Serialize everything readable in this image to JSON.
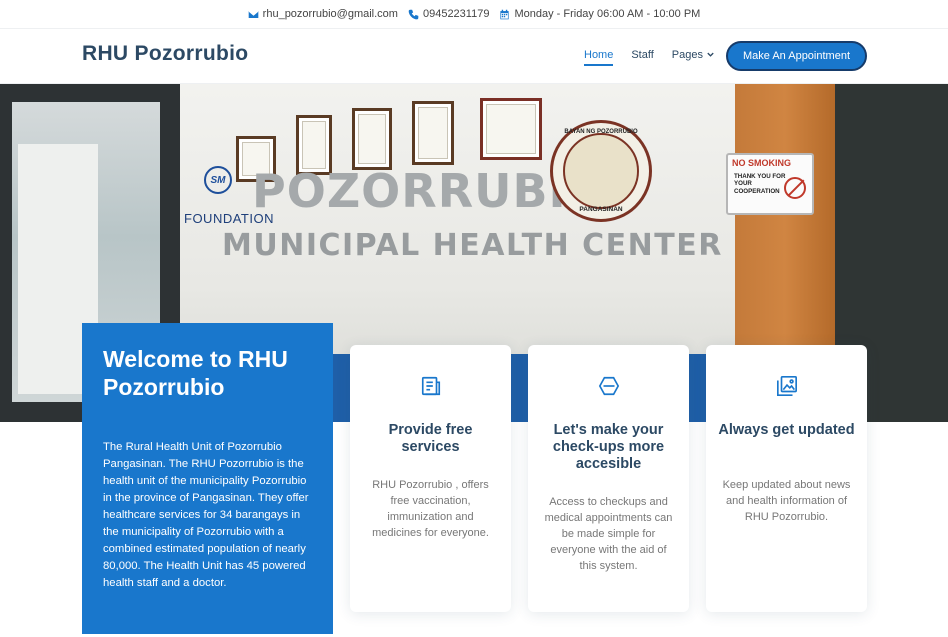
{
  "topbar": {
    "email": "rhu_pozorrubio@gmail.com",
    "phone": "09452231179",
    "hours": "Monday - Friday 06:00 AM - 10:00 PM",
    "email_icon": "envelope-icon",
    "phone_icon": "phone-icon",
    "hours_icon": "calendar-icon"
  },
  "header": {
    "logo": "RHU Pozorrubio",
    "nav": [
      {
        "label": "Home",
        "active": true
      },
      {
        "label": "Staff",
        "active": false
      },
      {
        "label": "Pages",
        "active": false,
        "dropdown": true
      }
    ],
    "cta": "Make An Appointment"
  },
  "hero": {
    "sign_line1": "POZORRUBIO",
    "sign_line2": "MUNICIPAL HEALTH CENTER",
    "sm_logo": "SM",
    "foundation": "FOUNDATION",
    "seal_top": "BAYAN NG POZORRUBIO",
    "seal_bottom": "PANGASINAN",
    "no_smoking_title": "NO SMOKING",
    "no_smoking_body": "THANK YOU FOR YOUR COOPERATION"
  },
  "welcome": {
    "title": "Welcome to RHU Pozorrubio",
    "body": "The Rural Health Unit of Pozorrubio Pangasinan. The RHU Pozorrubio is the health unit of the municipality Pozorrubio in the province of Pangasinan. They offer healthcare services for 34 barangays in the municipality of Pozorrubio with a combined estimated population of nearly 80,000. The Health Unit has 45 powered health staff and a doctor."
  },
  "cards": [
    {
      "icon": "document-list-icon",
      "title": "Provide free services",
      "text": "RHU Pozorrubio , offers free vaccination, immunization and medicines for everyone."
    },
    {
      "icon": "hexagon-cube-icon",
      "title": "Let's make your check-ups more accesible",
      "text": "Access to checkups and medical appointments can be made simple for everyone with the aid of this system."
    },
    {
      "icon": "images-icon",
      "title": "Always get updated",
      "text": "Keep updated about news and health information of RHU Pozorrubio."
    }
  ],
  "colors": {
    "primary": "#1977cc",
    "heading": "#2c4964",
    "muted": "#777777"
  }
}
